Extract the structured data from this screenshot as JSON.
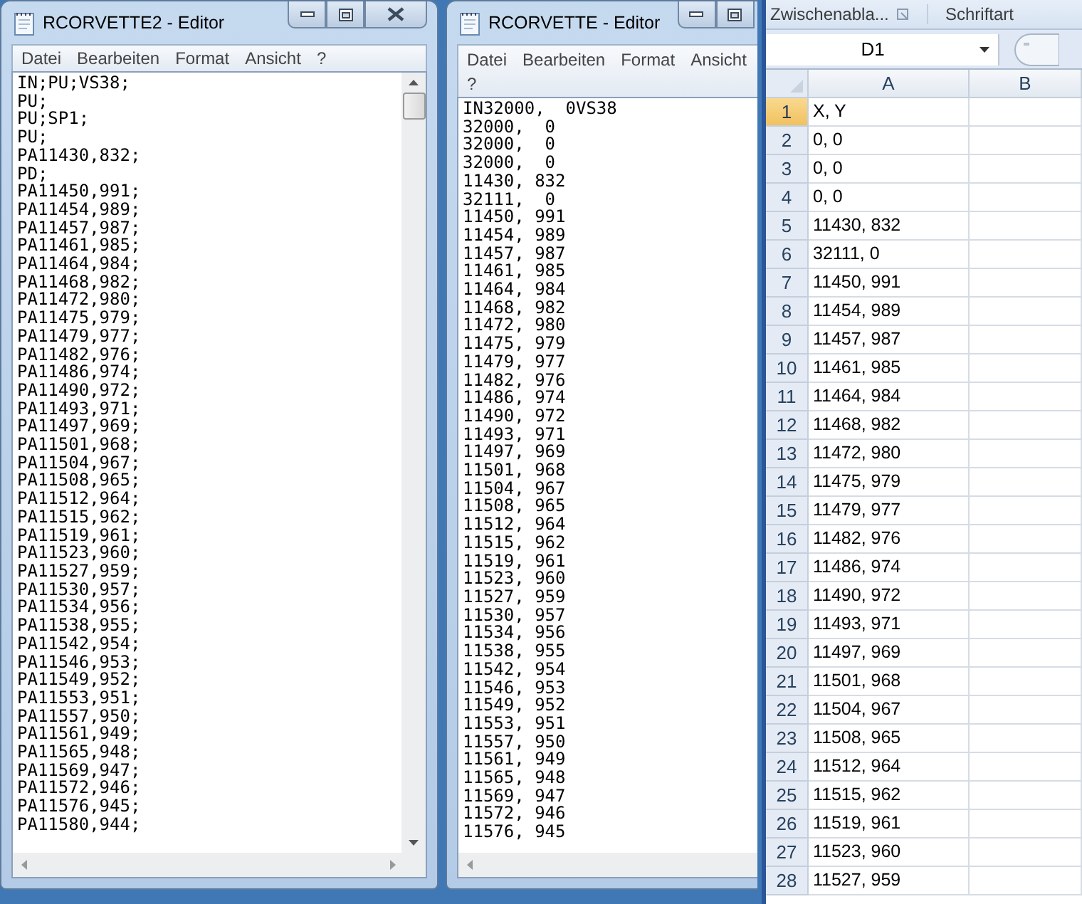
{
  "editors": [
    {
      "title": "RCORVETTE2 - Editor",
      "menu": [
        "Datei",
        "Bearbeiten",
        "Format",
        "Ansicht",
        "?"
      ],
      "lines": [
        "IN;PU;VS38;",
        "PU;",
        "PU;SP1;",
        "PU;",
        "PA11430,832;",
        "PD;",
        "PA11450,991;",
        "PA11454,989;",
        "PA11457,987;",
        "PA11461,985;",
        "PA11464,984;",
        "PA11468,982;",
        "PA11472,980;",
        "PA11475,979;",
        "PA11479,977;",
        "PA11482,976;",
        "PA11486,974;",
        "PA11490,972;",
        "PA11493,971;",
        "PA11497,969;",
        "PA11501,968;",
        "PA11504,967;",
        "PA11508,965;",
        "PA11512,964;",
        "PA11515,962;",
        "PA11519,961;",
        "PA11523,960;",
        "PA11527,959;",
        "PA11530,957;",
        "PA11534,956;",
        "PA11538,955;",
        "PA11542,954;",
        "PA11546,953;",
        "PA11549,952;",
        "PA11553,951;",
        "PA11557,950;",
        "PA11561,949;",
        "PA11565,948;",
        "PA11569,947;",
        "PA11572,946;",
        "PA11576,945;",
        "PA11580,944;"
      ]
    },
    {
      "title": "RCORVETTE - Editor",
      "menu": [
        "Datei",
        "Bearbeiten",
        "Format",
        "Ansicht",
        "?"
      ],
      "lines": [
        "IN32000,  0VS38",
        "32000,  0",
        "32000,  0",
        "32000,  0",
        "11430, 832",
        "32111,  0",
        "11450, 991",
        "11454, 989",
        "11457, 987",
        "11461, 985",
        "11464, 984",
        "11468, 982",
        "11472, 980",
        "11475, 979",
        "11479, 977",
        "11482, 976",
        "11486, 974",
        "11490, 972",
        "11493, 971",
        "11497, 969",
        "11501, 968",
        "11504, 967",
        "11508, 965",
        "11512, 964",
        "11515, 962",
        "11519, 961",
        "11523, 960",
        "11527, 959",
        "11530, 957",
        "11534, 956",
        "11538, 955",
        "11542, 954",
        "11546, 953",
        "11549, 952",
        "11553, 951",
        "11557, 950",
        "11561, 949",
        "11565, 948",
        "11569, 947",
        "11572, 946",
        "11576, 945"
      ]
    }
  ],
  "spreadsheet": {
    "ribbon_groups": [
      "Zwischenabla...",
      "Schriftart"
    ],
    "name_box": "D1",
    "columns": [
      "A",
      "B"
    ],
    "rows": [
      {
        "number": "1",
        "cells": [
          "X, Y",
          ""
        ],
        "selected": true
      },
      {
        "number": "2",
        "cells": [
          "0, 0",
          ""
        ],
        "selected": false
      },
      {
        "number": "3",
        "cells": [
          "0, 0",
          ""
        ],
        "selected": false
      },
      {
        "number": "4",
        "cells": [
          "0, 0",
          ""
        ],
        "selected": false
      },
      {
        "number": "5",
        "cells": [
          "11430, 832",
          ""
        ],
        "selected": false
      },
      {
        "number": "6",
        "cells": [
          "32111, 0",
          ""
        ],
        "selected": false
      },
      {
        "number": "7",
        "cells": [
          "11450, 991",
          ""
        ],
        "selected": false
      },
      {
        "number": "8",
        "cells": [
          "11454, 989",
          ""
        ],
        "selected": false
      },
      {
        "number": "9",
        "cells": [
          "11457, 987",
          ""
        ],
        "selected": false
      },
      {
        "number": "10",
        "cells": [
          "11461, 985",
          ""
        ],
        "selected": false
      },
      {
        "number": "11",
        "cells": [
          "11464, 984",
          ""
        ],
        "selected": false
      },
      {
        "number": "12",
        "cells": [
          "11468, 982",
          ""
        ],
        "selected": false
      },
      {
        "number": "13",
        "cells": [
          "11472, 980",
          ""
        ],
        "selected": false
      },
      {
        "number": "14",
        "cells": [
          "11475, 979",
          ""
        ],
        "selected": false
      },
      {
        "number": "15",
        "cells": [
          "11479, 977",
          ""
        ],
        "selected": false
      },
      {
        "number": "16",
        "cells": [
          "11482, 976",
          ""
        ],
        "selected": false
      },
      {
        "number": "17",
        "cells": [
          "11486, 974",
          ""
        ],
        "selected": false
      },
      {
        "number": "18",
        "cells": [
          "11490, 972",
          ""
        ],
        "selected": false
      },
      {
        "number": "19",
        "cells": [
          "11493, 971",
          ""
        ],
        "selected": false
      },
      {
        "number": "20",
        "cells": [
          "11497, 969",
          ""
        ],
        "selected": false
      },
      {
        "number": "21",
        "cells": [
          "11501, 968",
          ""
        ],
        "selected": false
      },
      {
        "number": "22",
        "cells": [
          "11504, 967",
          ""
        ],
        "selected": false
      },
      {
        "number": "23",
        "cells": [
          "11508, 965",
          ""
        ],
        "selected": false
      },
      {
        "number": "24",
        "cells": [
          "11512, 964",
          ""
        ],
        "selected": false
      },
      {
        "number": "25",
        "cells": [
          "11515, 962",
          ""
        ],
        "selected": false
      },
      {
        "number": "26",
        "cells": [
          "11519, 961",
          ""
        ],
        "selected": false
      },
      {
        "number": "27",
        "cells": [
          "11523, 960",
          ""
        ],
        "selected": false
      },
      {
        "number": "28",
        "cells": [
          "11527, 959",
          ""
        ],
        "selected": false
      }
    ]
  }
}
